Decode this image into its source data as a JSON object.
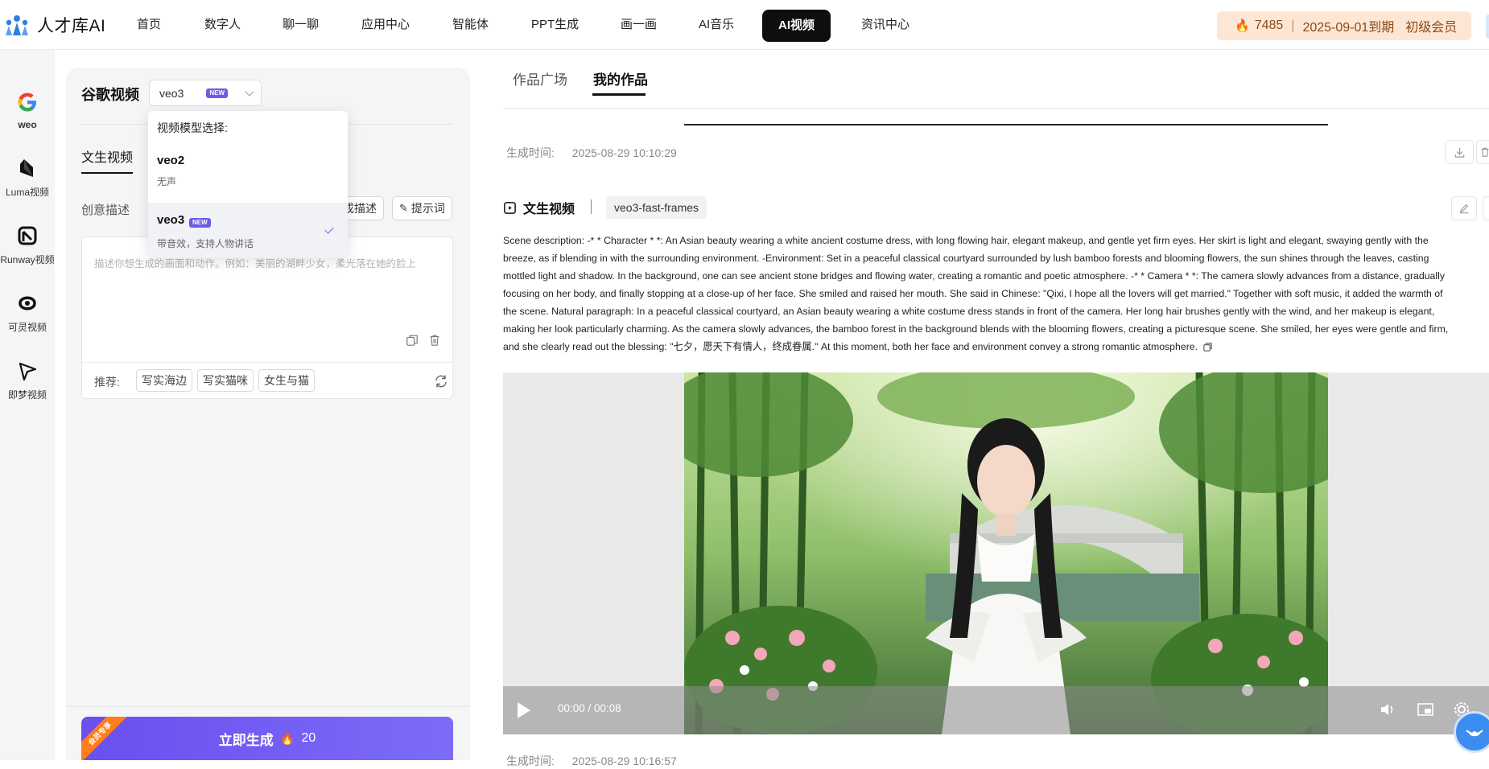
{
  "brand": {
    "name": "人才库AI"
  },
  "nav": {
    "items": [
      {
        "label": "首页"
      },
      {
        "label": "数字人"
      },
      {
        "label": "聊一聊"
      },
      {
        "label": "应用中心"
      },
      {
        "label": "智能体"
      },
      {
        "label": "PPT生成"
      },
      {
        "label": "画一画"
      },
      {
        "label": "AI音乐"
      },
      {
        "label": "AI视频",
        "active": true
      },
      {
        "label": "资讯中心"
      }
    ]
  },
  "member": {
    "points": "7485",
    "separator": "|",
    "expire": "2025-09-01到期",
    "level": "初级会员"
  },
  "rail": {
    "items": [
      {
        "label": "weo",
        "icon": "google-icon"
      },
      {
        "label": "Luma视频",
        "icon": "luma-icon"
      },
      {
        "label": "Runway视频",
        "icon": "runway-icon"
      },
      {
        "label": "可灵视频",
        "icon": "kling-icon"
      },
      {
        "label": "即梦视频",
        "icon": "jimeng-icon"
      }
    ]
  },
  "panel": {
    "title": "谷歌视频",
    "model_value": "veo3",
    "new_badge": "NEW",
    "tab": "文生视频",
    "creative_label": "创意描述",
    "gen_desc_button": "成描述",
    "prompt_button": "提示词",
    "placeholder": "描述你想生成的画面和动作。例如：美丽的湖畔少女，柔光落在她的脸上",
    "recommend_label": "推荐:",
    "recommend_chips": [
      "写实海边",
      "写实猫咪",
      "女生与猫"
    ],
    "generate_label": "立即生成",
    "generate_cost": "20",
    "ribbon": "会员专享"
  },
  "dropdown": {
    "header": "视频模型选择:",
    "options": [
      {
        "name": "veo2",
        "desc": "无声",
        "selected": false
      },
      {
        "name": "veo3",
        "badge": "NEW",
        "desc": "带音效，支持人物讲话",
        "selected": true
      }
    ]
  },
  "right": {
    "tabs": [
      {
        "label": "作品广场"
      },
      {
        "label": "我的作品",
        "active": true
      }
    ],
    "time_label": "生成时间:",
    "time_value": "2025-08-29 10:10:29",
    "section_title": "文生视频",
    "model_tag": "veo3-fast-frames",
    "prompt_lines": [
      "Scene description: -* * Character * *: An Asian beauty wearing a white ancient costume dress, with long flowing hair, elegant makeup, and gentle yet firm eyes. Her skirt is light and elegant, swaying gently with the",
      "breeze, as if blending in with the surrounding environment. -Environment: Set in a peaceful classical courtyard surrounded by lush bamboo forests and blooming flowers, the sun shines through the leaves, casting",
      "mottled light and shadow. In the background, one can see ancient stone bridges and flowing water, creating a romantic and poetic atmosphere. -* * Camera * *: The camera slowly advances from a distance, gradually",
      "focusing on her body, and finally stopping at a close-up of her face. She smiled and raised her mouth. She said in Chinese: \"Qixi, I hope all the lovers will get married.\" Together with soft music, it added the warmth of",
      "the scene. Natural paragraph: In a peaceful classical courtyard, an Asian beauty wearing a white costume dress stands in front of the camera. Her long hair brushes gently with the wind, and her makeup is elegant,",
      "making her look particularly charming. As the camera slowly advances, the bamboo forest in the background blends with the blooming flowers, creating a picturesque scene. She smiled, her eyes were gentle and firm,",
      "and she clearly read out the blessing: \"七夕，愿天下有情人，终成眷属.\" At this moment, both her face and environment convey a strong romantic atmosphere."
    ],
    "video_time": "00:00 / 00:08",
    "next_time_label": "生成时间:",
    "next_time_value": "2025-08-29 10:16:57"
  }
}
